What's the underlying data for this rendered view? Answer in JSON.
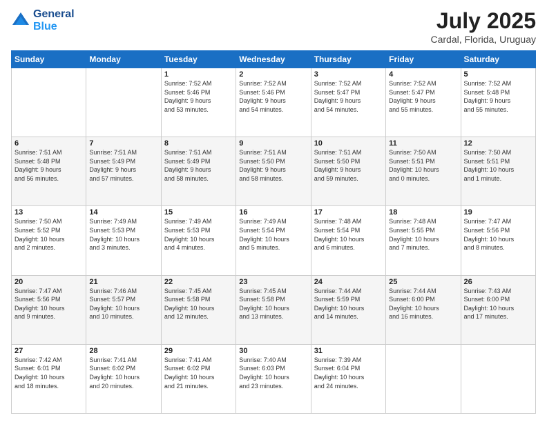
{
  "logo": {
    "line1": "General",
    "line2": "Blue"
  },
  "title": "July 2025",
  "location": "Cardal, Florida, Uruguay",
  "days_header": [
    "Sunday",
    "Monday",
    "Tuesday",
    "Wednesday",
    "Thursday",
    "Friday",
    "Saturday"
  ],
  "weeks": [
    [
      {
        "day": "",
        "info": ""
      },
      {
        "day": "",
        "info": ""
      },
      {
        "day": "1",
        "info": "Sunrise: 7:52 AM\nSunset: 5:46 PM\nDaylight: 9 hours\nand 53 minutes."
      },
      {
        "day": "2",
        "info": "Sunrise: 7:52 AM\nSunset: 5:46 PM\nDaylight: 9 hours\nand 54 minutes."
      },
      {
        "day": "3",
        "info": "Sunrise: 7:52 AM\nSunset: 5:47 PM\nDaylight: 9 hours\nand 54 minutes."
      },
      {
        "day": "4",
        "info": "Sunrise: 7:52 AM\nSunset: 5:47 PM\nDaylight: 9 hours\nand 55 minutes."
      },
      {
        "day": "5",
        "info": "Sunrise: 7:52 AM\nSunset: 5:48 PM\nDaylight: 9 hours\nand 55 minutes."
      }
    ],
    [
      {
        "day": "6",
        "info": "Sunrise: 7:51 AM\nSunset: 5:48 PM\nDaylight: 9 hours\nand 56 minutes."
      },
      {
        "day": "7",
        "info": "Sunrise: 7:51 AM\nSunset: 5:49 PM\nDaylight: 9 hours\nand 57 minutes."
      },
      {
        "day": "8",
        "info": "Sunrise: 7:51 AM\nSunset: 5:49 PM\nDaylight: 9 hours\nand 58 minutes."
      },
      {
        "day": "9",
        "info": "Sunrise: 7:51 AM\nSunset: 5:50 PM\nDaylight: 9 hours\nand 58 minutes."
      },
      {
        "day": "10",
        "info": "Sunrise: 7:51 AM\nSunset: 5:50 PM\nDaylight: 9 hours\nand 59 minutes."
      },
      {
        "day": "11",
        "info": "Sunrise: 7:50 AM\nSunset: 5:51 PM\nDaylight: 10 hours\nand 0 minutes."
      },
      {
        "day": "12",
        "info": "Sunrise: 7:50 AM\nSunset: 5:51 PM\nDaylight: 10 hours\nand 1 minute."
      }
    ],
    [
      {
        "day": "13",
        "info": "Sunrise: 7:50 AM\nSunset: 5:52 PM\nDaylight: 10 hours\nand 2 minutes."
      },
      {
        "day": "14",
        "info": "Sunrise: 7:49 AM\nSunset: 5:53 PM\nDaylight: 10 hours\nand 3 minutes."
      },
      {
        "day": "15",
        "info": "Sunrise: 7:49 AM\nSunset: 5:53 PM\nDaylight: 10 hours\nand 4 minutes."
      },
      {
        "day": "16",
        "info": "Sunrise: 7:49 AM\nSunset: 5:54 PM\nDaylight: 10 hours\nand 5 minutes."
      },
      {
        "day": "17",
        "info": "Sunrise: 7:48 AM\nSunset: 5:54 PM\nDaylight: 10 hours\nand 6 minutes."
      },
      {
        "day": "18",
        "info": "Sunrise: 7:48 AM\nSunset: 5:55 PM\nDaylight: 10 hours\nand 7 minutes."
      },
      {
        "day": "19",
        "info": "Sunrise: 7:47 AM\nSunset: 5:56 PM\nDaylight: 10 hours\nand 8 minutes."
      }
    ],
    [
      {
        "day": "20",
        "info": "Sunrise: 7:47 AM\nSunset: 5:56 PM\nDaylight: 10 hours\nand 9 minutes."
      },
      {
        "day": "21",
        "info": "Sunrise: 7:46 AM\nSunset: 5:57 PM\nDaylight: 10 hours\nand 10 minutes."
      },
      {
        "day": "22",
        "info": "Sunrise: 7:45 AM\nSunset: 5:58 PM\nDaylight: 10 hours\nand 12 minutes."
      },
      {
        "day": "23",
        "info": "Sunrise: 7:45 AM\nSunset: 5:58 PM\nDaylight: 10 hours\nand 13 minutes."
      },
      {
        "day": "24",
        "info": "Sunrise: 7:44 AM\nSunset: 5:59 PM\nDaylight: 10 hours\nand 14 minutes."
      },
      {
        "day": "25",
        "info": "Sunrise: 7:44 AM\nSunset: 6:00 PM\nDaylight: 10 hours\nand 16 minutes."
      },
      {
        "day": "26",
        "info": "Sunrise: 7:43 AM\nSunset: 6:00 PM\nDaylight: 10 hours\nand 17 minutes."
      }
    ],
    [
      {
        "day": "27",
        "info": "Sunrise: 7:42 AM\nSunset: 6:01 PM\nDaylight: 10 hours\nand 18 minutes."
      },
      {
        "day": "28",
        "info": "Sunrise: 7:41 AM\nSunset: 6:02 PM\nDaylight: 10 hours\nand 20 minutes."
      },
      {
        "day": "29",
        "info": "Sunrise: 7:41 AM\nSunset: 6:02 PM\nDaylight: 10 hours\nand 21 minutes."
      },
      {
        "day": "30",
        "info": "Sunrise: 7:40 AM\nSunset: 6:03 PM\nDaylight: 10 hours\nand 23 minutes."
      },
      {
        "day": "31",
        "info": "Sunrise: 7:39 AM\nSunset: 6:04 PM\nDaylight: 10 hours\nand 24 minutes."
      },
      {
        "day": "",
        "info": ""
      },
      {
        "day": "",
        "info": ""
      }
    ]
  ]
}
